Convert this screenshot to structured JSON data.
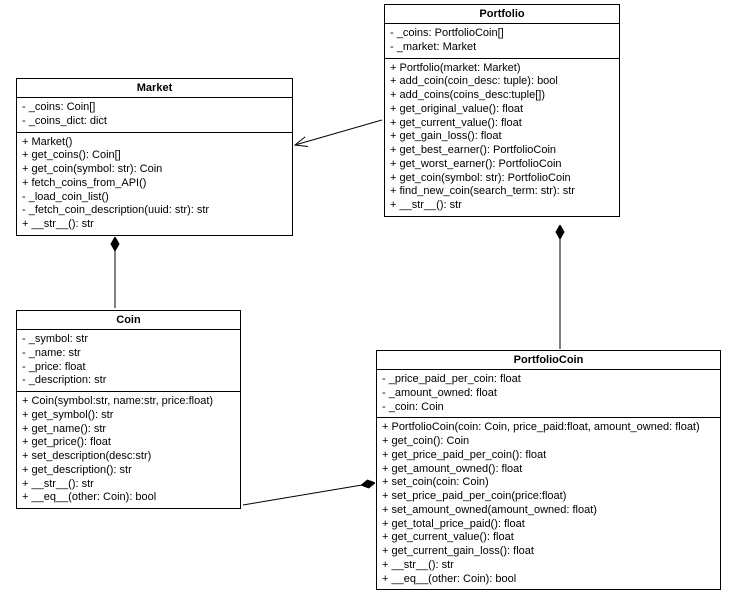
{
  "classes": {
    "market": {
      "name": "Market",
      "attributes": [
        "- _coins: Coin[]",
        "- _coins_dict: dict"
      ],
      "methods": [
        "+ Market()",
        "+ get_coins(): Coin[]",
        "+ get_coin(symbol: str): Coin",
        "+ fetch_coins_from_API()",
        "- _load_coin_list()",
        "- _fetch_coin_description(uuid: str): str",
        "+ __str__(): str"
      ]
    },
    "portfolio": {
      "name": "Portfolio",
      "attributes": [
        "- _coins: PortfolioCoin[]",
        "- _market: Market"
      ],
      "methods": [
        "+ Portfolio(market: Market)",
        "+ add_coin(coin_desc: tuple): bool",
        "+ add_coins(coins_desc:tuple[])",
        "+ get_original_value(): float",
        "+ get_current_value(): float",
        "+ get_gain_loss(): float",
        "+ get_best_earner(): PortfolioCoin",
        "+ get_worst_earner(): PortfolioCoin",
        "+ get_coin(symbol: str): PortfolioCoin",
        "+ find_new_coin(search_term: str): str",
        "+ __str__(): str"
      ]
    },
    "coin": {
      "name": "Coin",
      "attributes": [
        "- _symbol: str",
        "- _name: str",
        "- _price: float",
        "- _description: str"
      ],
      "methods": [
        "+ Coin(symbol:str, name:str, price:float)",
        "+ get_symbol(): str",
        "+ get_name(): str",
        "+ get_price(): float",
        "+ set_description(desc:str)",
        "+ get_description(): str",
        "+ __str__(): str",
        "+ __eq__(other: Coin): bool"
      ]
    },
    "portfoliocoin": {
      "name": "PortfolioCoin",
      "attributes": [
        "- _price_paid_per_coin: float",
        "- _amount_owned: float",
        "- _coin: Coin"
      ],
      "methods": [
        "+ PortfolioCoin(coin: Coin, price_paid:float, amount_owned: float)",
        "+ get_coin(): Coin",
        "+ get_price_paid_per_coin(): float",
        "+ get_amount_owned(): float",
        "+ set_coin(coin: Coin)",
        "+ set_price_paid_per_coin(price:float)",
        "+ set_amount_owned(amount_owned: float)",
        "+ get_total_price_paid(): float",
        "+ get_current_value(): float",
        "+ get_current_gain_loss(): float",
        "+ __str__(): str",
        "+ __eq__(other: Coin): bool"
      ]
    }
  }
}
